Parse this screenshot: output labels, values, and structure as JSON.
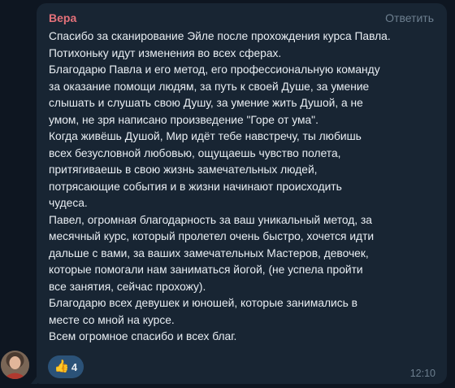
{
  "message": {
    "sender": "Вера",
    "reply_label": "Ответить",
    "lines": [
      "Спасибо за сканирование Эйле после прохождения курса Павла.",
      "Потихоньку идут изменения во всех сферах.",
      "Благодарю Павла и его метод, его профессиональную команду",
      "за оказание помощи людям, за путь к своей Душе, за умение",
      "слышать и слушать свою Душу, за умение жить Душой, а не",
      "умом, не зря написано произведение \"Горе от ума\".",
      "Когда живёшь Душой, Мир идёт тебе навстречу, ты любишь",
      "всех безусловной любовью, ощущаешь чувство полета,",
      "притягиваешь в свою жизнь замечательных людей,",
      "потрясающие события и в жизни начинают  происходить",
      "чудеса.",
      "Павел, огромная благодарность за ваш уникальный метод, за",
      "месячный курс, который пролетел очень быстро, хочется идти",
      "дальше с вами, за ваших замечательных Мастеров, девочек,",
      "которые помогали нам заниматься йогой, (не успела пройти",
      "все занятия, сейчас прохожу).",
      "Благодарю всех девушек и юношей, которые занимались в",
      "месте со мной на курсе.",
      "Всем огромное спасибо и всех благ."
    ],
    "reaction": {
      "icon": "thumbs-up-icon",
      "emoji": "👍",
      "count": "4"
    },
    "time": "12:10"
  },
  "colors": {
    "background": "#0e1621",
    "bubble": "#182533",
    "sender": "#e4717a",
    "text": "#e9eef3",
    "muted": "#6d7f8f",
    "reaction_bg": "#2b5278"
  }
}
